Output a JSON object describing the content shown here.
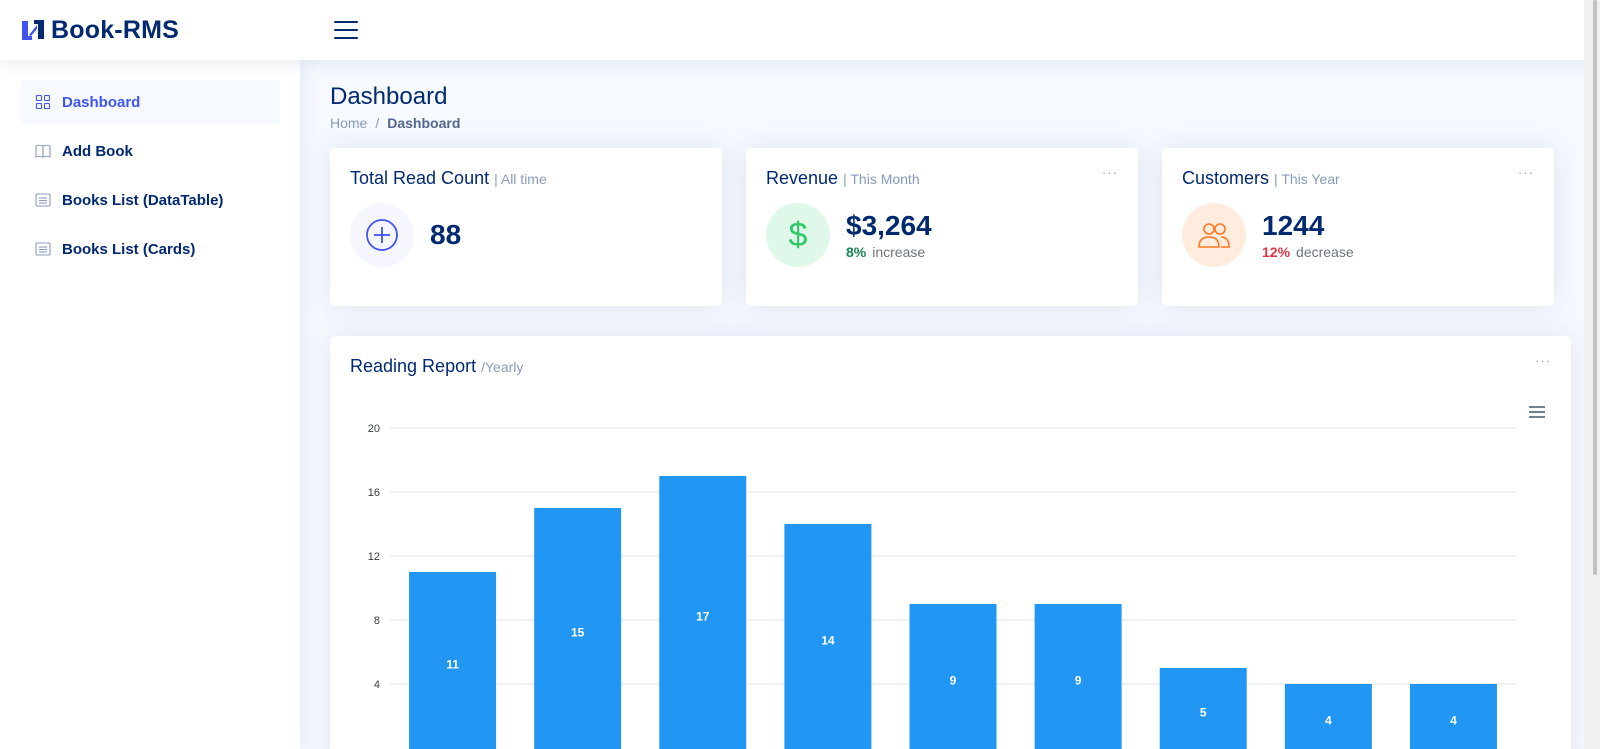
{
  "brand": {
    "name": "Book-RMS"
  },
  "sidebar": {
    "items": [
      {
        "label": "Dashboard",
        "icon": "grid-icon",
        "active": true
      },
      {
        "label": "Add Book",
        "icon": "book-icon",
        "active": false
      },
      {
        "label": "Books List (DataTable)",
        "icon": "list-icon",
        "active": false
      },
      {
        "label": "Books List (Cards)",
        "icon": "list-icon",
        "active": false
      }
    ]
  },
  "page": {
    "title": "Dashboard",
    "breadcrumb": {
      "home": "Home",
      "separator": "/",
      "current": "Dashboard"
    }
  },
  "cards": [
    {
      "title": "Total Read Count",
      "subtitle": "| All time",
      "value": "88",
      "icon": "plus-circle-icon"
    },
    {
      "title": "Revenue",
      "subtitle": "| This Month",
      "value": "$3,264",
      "percent": "8%",
      "trend": "increase",
      "icon": "dollar-icon",
      "menu": "···"
    },
    {
      "title": "Customers",
      "subtitle": "| This Year",
      "value": "1244",
      "percent": "12%",
      "trend": "decrease",
      "icon": "people-icon",
      "menu": "···"
    }
  ],
  "report": {
    "title": "Reading Report",
    "subtitle": "/Yearly",
    "menu": "···"
  },
  "colors": {
    "accent": "#4154f1",
    "bar": "#2196f3",
    "navy": "#012970"
  },
  "chart_data": {
    "type": "bar",
    "categories": [
      "",
      "",
      "",
      "",
      "",
      "",
      "",
      "",
      ""
    ],
    "values": [
      11,
      15,
      17,
      14,
      9,
      9,
      5,
      4,
      4
    ],
    "yticks": [
      "4",
      "8",
      "12",
      "16",
      "20"
    ],
    "ylim": [
      0,
      20
    ],
    "grid": true,
    "data_labels": true
  }
}
